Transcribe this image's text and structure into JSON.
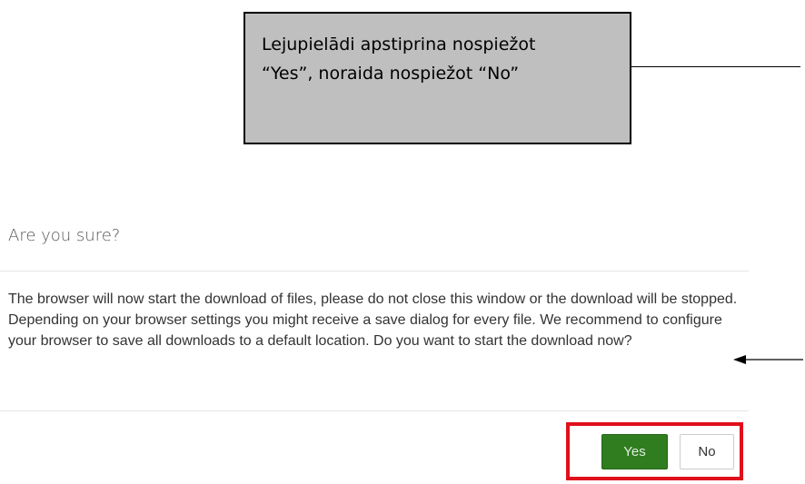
{
  "annotation": {
    "callout_text": "Lejupielādi apstiprina nospiežot\n“Yes”, noraida nospiežot “No”"
  },
  "dialog": {
    "title": "Are you sure?",
    "body": "The browser will now start the download of files, please do not close this window or the download will be stopped. Depending on your browser settings you might receive a save dialog for every file. We recommend to configure your browser to save all downloads to a default location. Do you want to start the download now?",
    "buttons": {
      "yes_label": "Yes",
      "no_label": "No"
    }
  },
  "colors": {
    "callout_fill": "#bfbfbf",
    "highlight_border": "#e0101a",
    "yes_button": "#2f7d1f"
  }
}
